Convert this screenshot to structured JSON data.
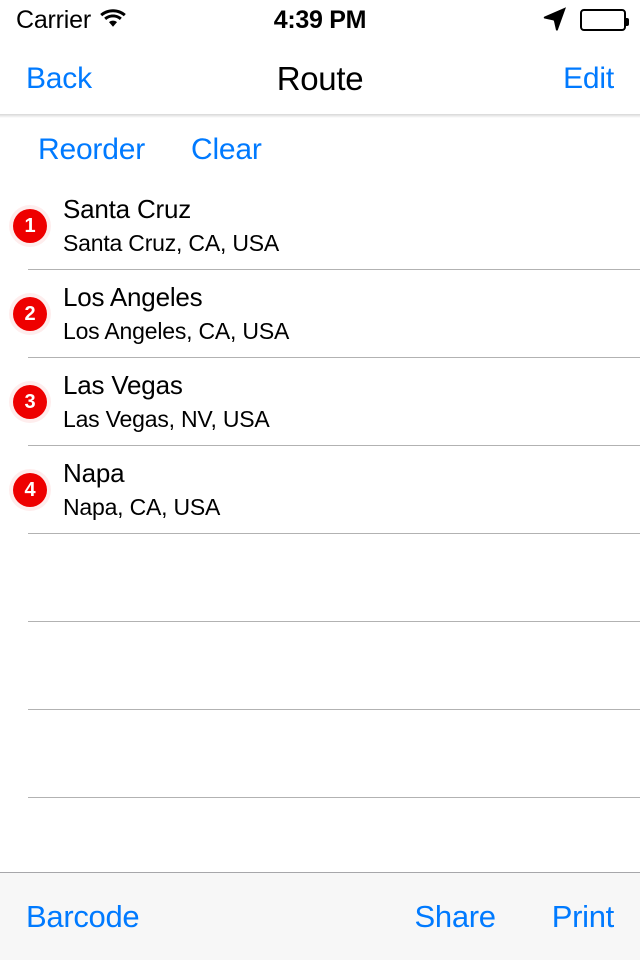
{
  "status_bar": {
    "carrier": "Carrier",
    "wifi_icon": "wifi-icon",
    "time": "4:39 PM",
    "location_icon": "location-arrow-icon",
    "battery_icon": "battery-full-icon"
  },
  "nav_bar": {
    "back_label": "Back",
    "title": "Route",
    "edit_label": "Edit"
  },
  "toolbar_top": {
    "reorder_label": "Reorder",
    "clear_label": "Clear"
  },
  "route_stops": [
    {
      "number": "1",
      "name": "Santa Cruz",
      "address": "Santa Cruz, CA, USA"
    },
    {
      "number": "2",
      "name": "Los Angeles",
      "address": "Los Angeles, CA, USA"
    },
    {
      "number": "3",
      "name": "Las Vegas",
      "address": "Las Vegas, NV, USA"
    },
    {
      "number": "4",
      "name": "Napa",
      "address": "Napa, CA, USA"
    }
  ],
  "empty_row_count": 4,
  "toolbar_bottom": {
    "barcode_label": "Barcode",
    "share_label": "Share",
    "print_label": "Print"
  },
  "colors": {
    "tint_blue": "#007aff",
    "badge_red": "#ee0000",
    "separator": "#b2b2b2",
    "toolbar_bg": "#f7f7f7"
  }
}
